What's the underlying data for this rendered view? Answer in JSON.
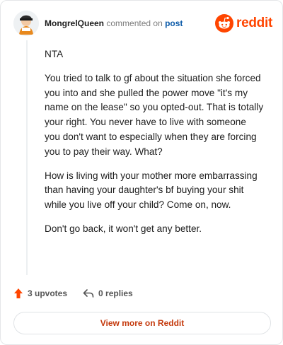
{
  "header": {
    "username": "MongrelQueen",
    "action_text": "commented on",
    "post_link": "post",
    "brand_name": "reddit"
  },
  "comment": {
    "paragraphs": [
      "NTA",
      "You tried to talk to gf about the situation she forced you into and she pulled the power move \"it's my name on the lease\" so you opted-out. That is totally your right. You never have to live with someone you don't want to especially when they are forcing you to pay their way. What?",
      "How is living with your mother more embarrassing than having your daughter's bf buying your shit while you live off your child? Come on, now.",
      "Don't go back, it won't get any better."
    ]
  },
  "footer": {
    "upvotes_label": "3 upvotes",
    "replies_label": "0 replies",
    "view_more_label": "View more on Reddit"
  },
  "icons": {
    "avatar": "user-avatar-icon",
    "brand": "reddit-logo-icon",
    "upvote": "upvote-arrow-icon",
    "reply": "reply-arrow-icon"
  },
  "colors": {
    "brand": "#ff4500",
    "link": "#0b5aa8",
    "view_more": "#c4390c",
    "upvote": "#ff4500"
  }
}
